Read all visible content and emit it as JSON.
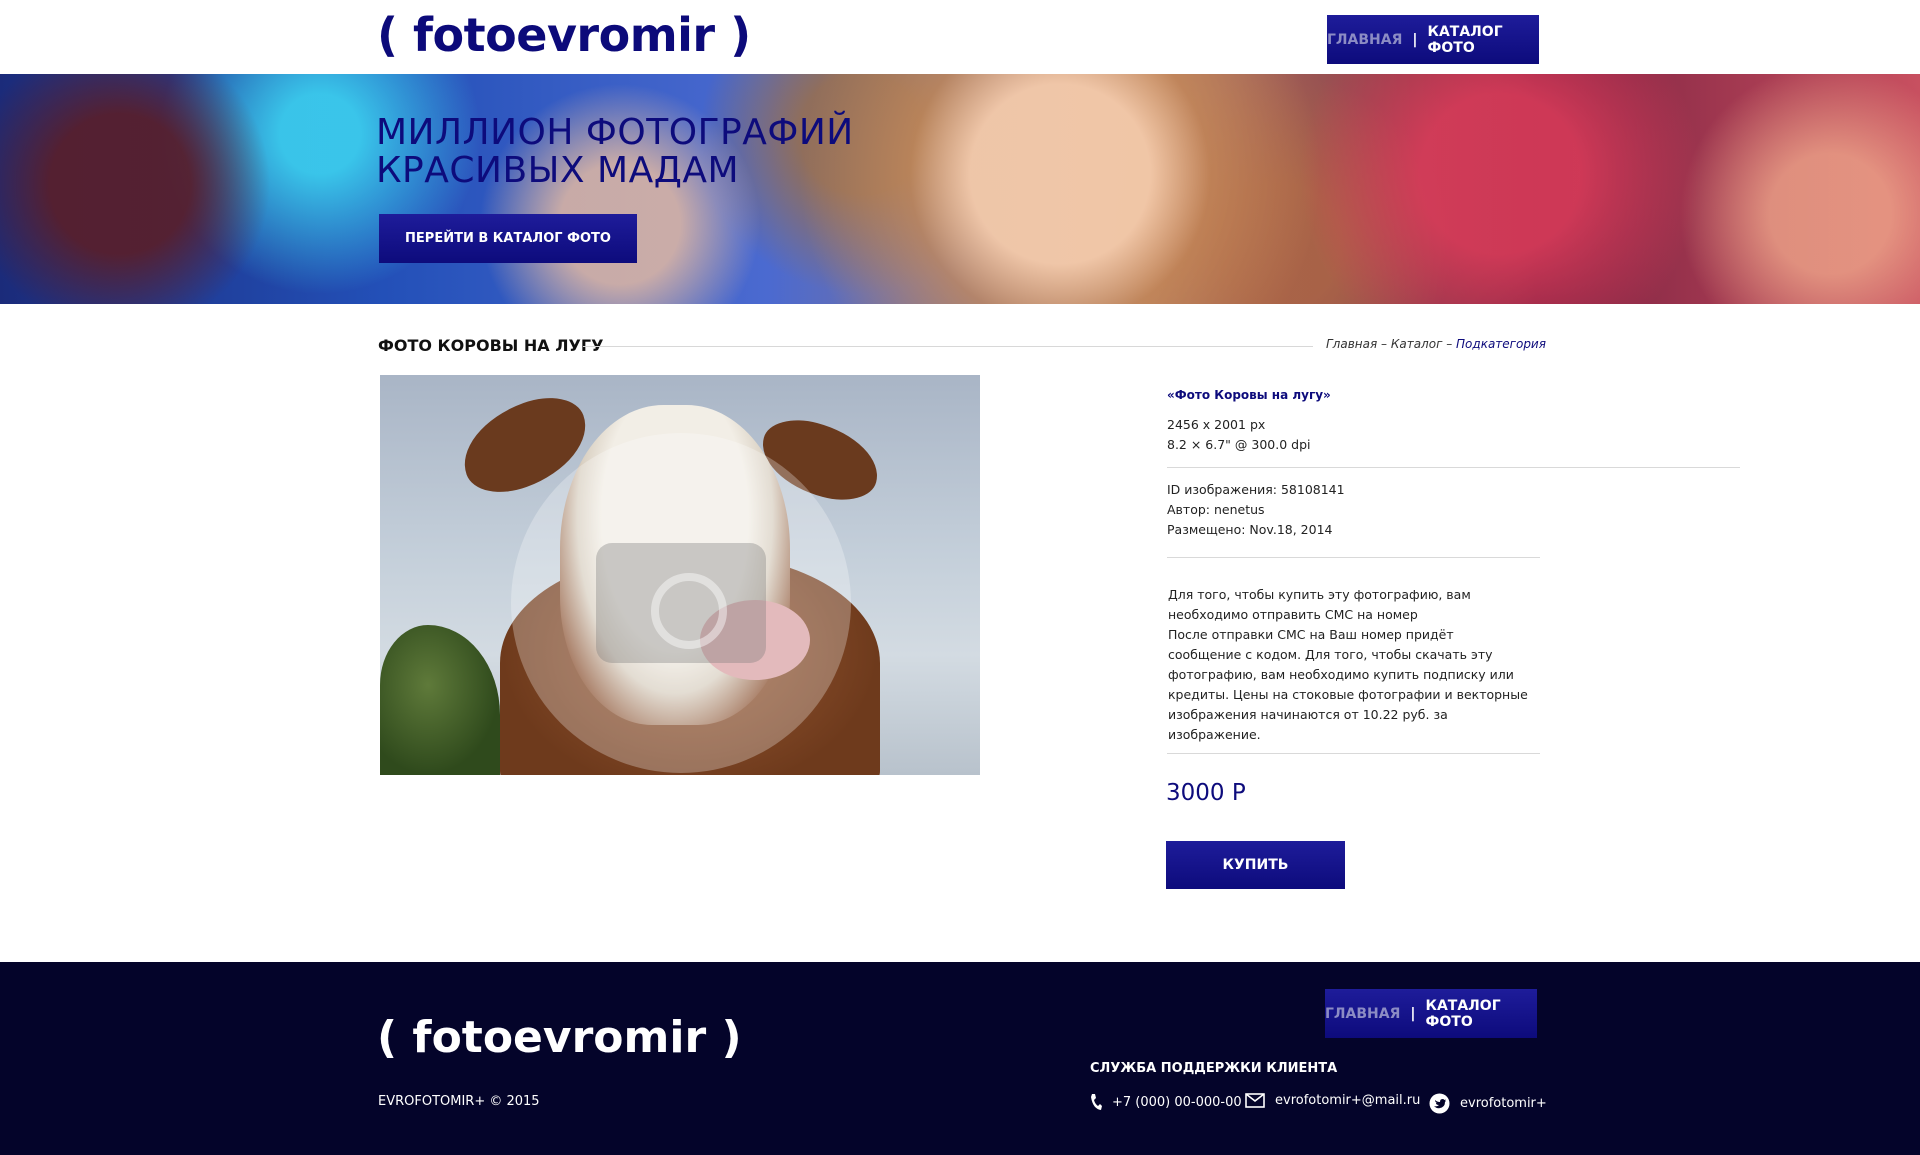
{
  "header": {
    "logo": "( fotoevromir )",
    "nav": {
      "home": "ГЛАВНАЯ",
      "separator": "|",
      "catalog": "КАТАЛОГ ФОТО"
    }
  },
  "hero": {
    "title_line1": "МИЛЛИОН ФОТОГРАФИЙ",
    "title_line2": "КРАСИВЫХ МАДАМ",
    "button": "ПЕРЕЙТИ В КАТАЛОГ ФОТО"
  },
  "section": {
    "title": "ФОТО КОРОВЫ НА ЛУГУ",
    "breadcrumb": {
      "home": "Главная",
      "sep1": " – ",
      "catalog": "Каталог",
      "sep2": " – ",
      "current": "Подкатегория"
    }
  },
  "photo": {
    "watermark_icon": "camera-icon"
  },
  "info": {
    "title": "«Фото Коровы на лугу»",
    "size_px": "2456 x 2001 px",
    "size_print": "8.2 × 6.7\" @ 300.0 dpi",
    "image_id": "ID изображения: 58108141",
    "author": "Автор: nenetus",
    "posted": "Размещено: Nov.18, 2014",
    "description": "Для того, чтобы купить эту фотографию, вам необходимо отправить СМС на номер\nПосле отправки СМС на Ваш номер придёт сообщение с кодом.  Для того, чтобы скачать эту фотографию, вам необходимо купить подписку или кредиты. Цены на стоковые фотографии и векторные изображения начинаются от 10.22 руб. за изображение.",
    "price": "3000 Р",
    "buy_button": "КУПИТЬ"
  },
  "footer": {
    "logo": "( fotoevromir )",
    "copyright": "EVROFOTOMIR+ © 2015",
    "nav": {
      "home": "ГЛАВНАЯ",
      "separator": "|",
      "catalog": "КАТАЛОГ ФОТО"
    },
    "support_title": "СЛУЖБА ПОДДЕРЖКИ КЛИЕНТА",
    "phone": "+7 (000) 00-000-00",
    "email": "evrofotomir+@mail.ru",
    "twitter": "evrofotomir+"
  },
  "colors": {
    "brand": "#0d0b7c",
    "footer_bg": "#04042a"
  }
}
